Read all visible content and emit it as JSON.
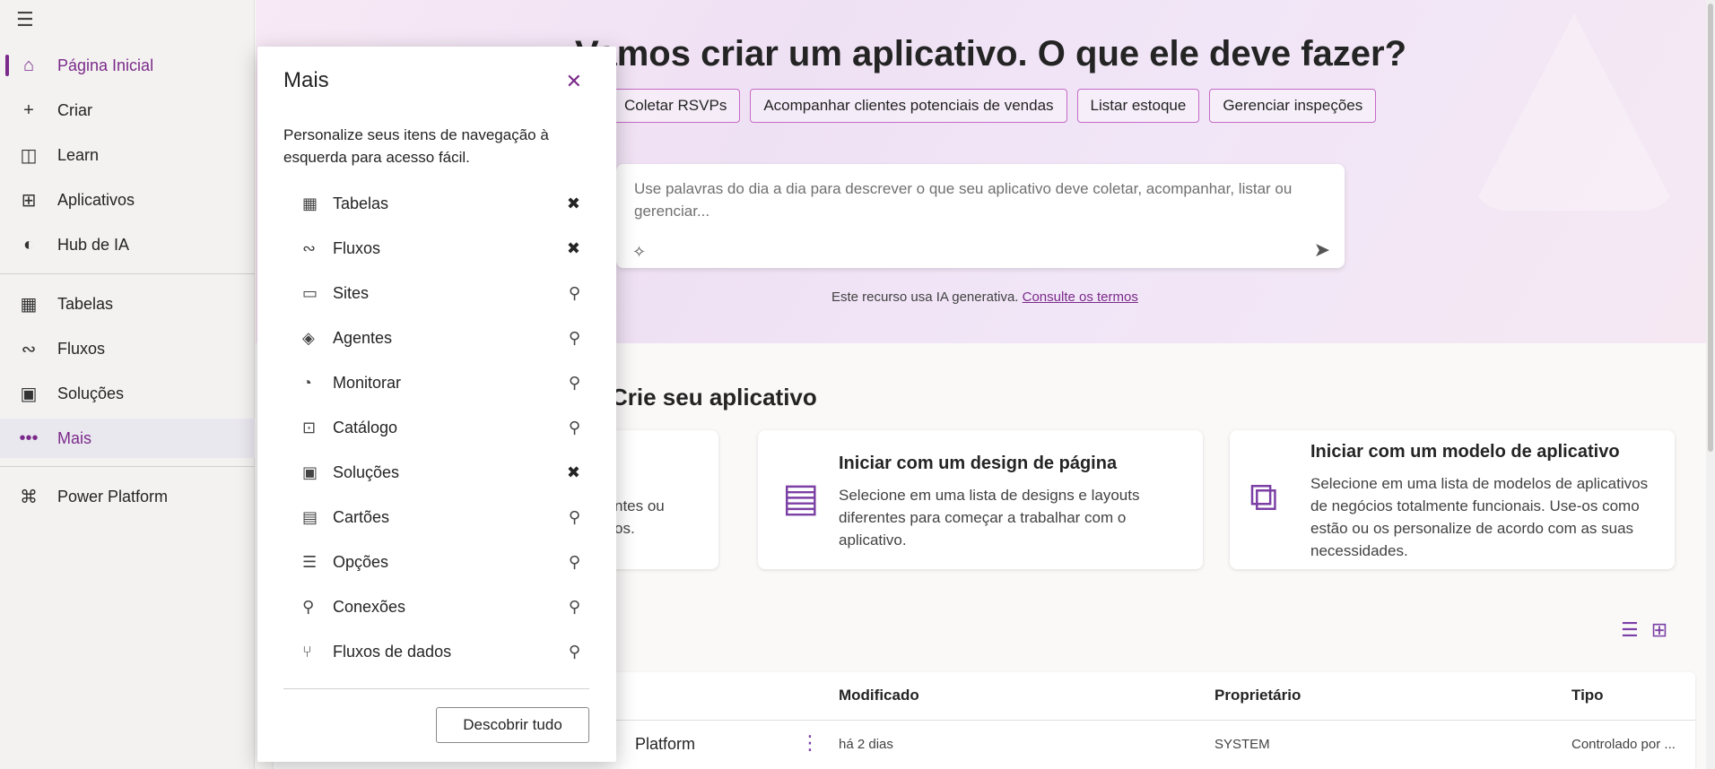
{
  "nav": {
    "menu_icon": "hamburger-icon",
    "items": [
      {
        "label": "Página Inicial",
        "icon": "home-icon",
        "glyph": "⌂"
      },
      {
        "label": "Criar",
        "icon": "plus-icon",
        "glyph": "+"
      },
      {
        "label": "Learn",
        "icon": "book-icon",
        "glyph": "📖"
      },
      {
        "label": "Aplicativos",
        "icon": "apps-icon",
        "glyph": "⊞"
      },
      {
        "label": "Hub de IA",
        "icon": "ai-hub-icon",
        "glyph": "◐"
      },
      {
        "label": "Tabelas",
        "icon": "table-icon",
        "glyph": "▦"
      },
      {
        "label": "Fluxos",
        "icon": "flow-icon",
        "glyph": "∾"
      },
      {
        "label": "Soluções",
        "icon": "solutions-icon",
        "glyph": "▣"
      },
      {
        "label": "Mais",
        "icon": "more-icon",
        "glyph": "•••"
      },
      {
        "label": "Power Platform",
        "icon": "power-platform-icon",
        "glyph": "⌘"
      }
    ]
  },
  "hero": {
    "title": "Vamos criar um aplicativo. O que ele deve fazer?",
    "chips": [
      "Coletar RSVPs",
      "Acompanhar clientes potenciais de vendas",
      "Listar estoque",
      "Gerenciar inspeções"
    ],
    "prompt_placeholder": "Use palavras do dia a dia para descrever o que seu aplicativo deve coletar, acompanhar, listar ou gerenciar...",
    "disclaimer": "Este recurso usa IA generativa.",
    "terms_link": "Consulte os termos"
  },
  "section": {
    "title": "Crie seu aplicativo"
  },
  "cards": [
    {
      "title": "",
      "desc": "ntes ou\nos."
    },
    {
      "title": "Iniciar com um design de página",
      "desc": "Selecione em uma lista de designs e layouts diferentes para começar a trabalhar com o aplicativo."
    },
    {
      "title": "Iniciar com um modelo de aplicativo",
      "desc": "Selecione em uma lista de modelos de aplicativos de negócios totalmente funcionais. Use-os como estão ou os personalize de acordo com as suas necessidades."
    }
  ],
  "table": {
    "headers": {
      "modified": "Modificado",
      "owner": "Proprietário",
      "type": "Tipo"
    },
    "rows": [
      {
        "name": "Platform",
        "modified": "há 2 dias",
        "owner": "SYSTEM",
        "type": "Controlado por ..."
      }
    ]
  },
  "panel": {
    "title": "Mais",
    "description": "Personalize seus itens de navegação à esquerda para acesso fácil.",
    "items": [
      {
        "label": "Tabelas",
        "icon": "table-icon",
        "glyph": "▦",
        "pinned": true
      },
      {
        "label": "Fluxos",
        "icon": "flow-icon",
        "glyph": "∾",
        "pinned": true
      },
      {
        "label": "Sites",
        "icon": "sites-icon",
        "glyph": "▭",
        "pinned": false
      },
      {
        "label": "Agentes",
        "icon": "agents-icon",
        "glyph": "◈",
        "pinned": false
      },
      {
        "label": "Monitorar",
        "icon": "monitor-icon",
        "glyph": "◔",
        "pinned": false
      },
      {
        "label": "Catálogo",
        "icon": "catalog-icon",
        "glyph": "⊡",
        "pinned": false
      },
      {
        "label": "Soluções",
        "icon": "solutions-icon",
        "glyph": "▣",
        "pinned": true
      },
      {
        "label": "Cartões",
        "icon": "cards-icon",
        "glyph": "▤",
        "pinned": false
      },
      {
        "label": "Opções",
        "icon": "options-icon",
        "glyph": "☰",
        "pinned": false
      },
      {
        "label": "Conexões",
        "icon": "connections-icon",
        "glyph": "⚲",
        "pinned": false
      },
      {
        "label": "Fluxos de dados",
        "icon": "dataflows-icon",
        "glyph": "⑂",
        "pinned": false
      }
    ],
    "discover_label": "Descobrir tudo"
  }
}
